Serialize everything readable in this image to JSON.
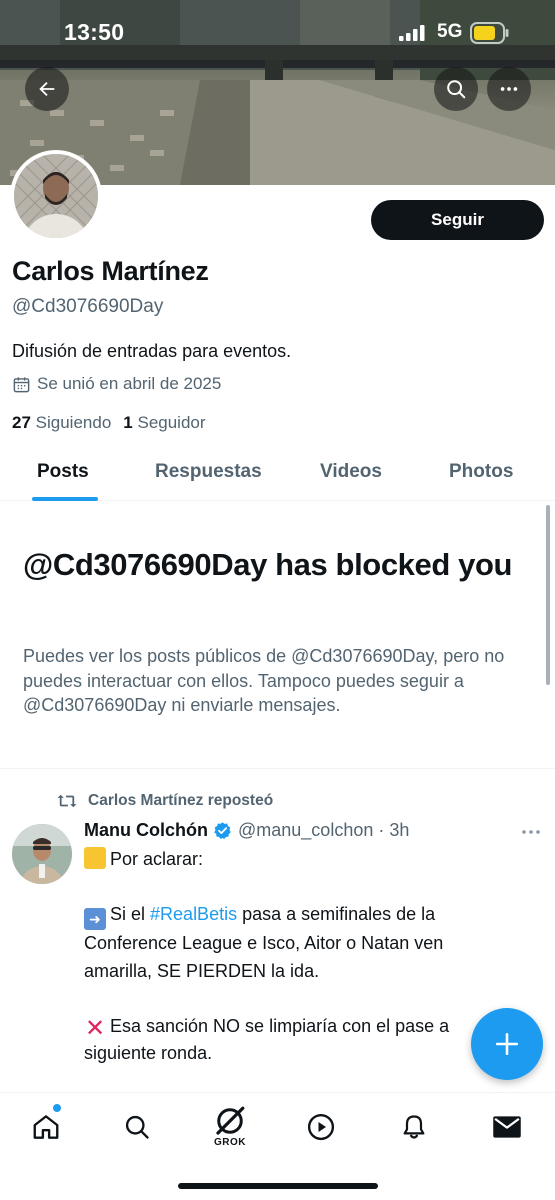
{
  "status_bar": {
    "time": "13:50",
    "network": "5G"
  },
  "profile": {
    "follow_label": "Seguir",
    "name": "Carlos Martínez",
    "handle": "@Cd3076690Day",
    "bio": "Difusión de entradas para eventos.",
    "joined": "Se unió en abril de 2025",
    "following_count": "27",
    "following_label": "Siguiendo",
    "followers_count": "1",
    "followers_label": "Seguidor"
  },
  "tabs": [
    {
      "label": "Posts",
      "active": true
    },
    {
      "label": "Respuestas",
      "active": false
    },
    {
      "label": "Videos",
      "active": false
    },
    {
      "label": "Photos",
      "active": false
    }
  ],
  "blocked": {
    "title": "@Cd3076690Day has blocked you",
    "description": "Puedes ver los posts públicos de @Cd3076690Day, pero no puedes interactuar con ellos. Tampoco puedes seguir a @Cd3076690Day ni enviarle mensajes."
  },
  "post": {
    "repost_label": "Carlos Martínez reposteó",
    "author_name": "Manu Colchón",
    "author_handle": "@manu_colchon",
    "time": "3h",
    "line1": "Por aclarar:",
    "line2_pre": "Si el ",
    "line2_hashtag": "#RealBetis",
    "line2_post": " pasa a semifinales de la Conference League e Isco, Aitor o Natan ven amarilla, SE PIERDEN la ida.",
    "line3": "Esa sanción NO se limpiaría con el pase a siguiente ronda."
  },
  "nav": {
    "grok_label": "GROK"
  },
  "colors": {
    "accent": "#1d9bf0",
    "text": "#0f1419",
    "secondary": "#536471",
    "verified": "#1d9bf0"
  }
}
